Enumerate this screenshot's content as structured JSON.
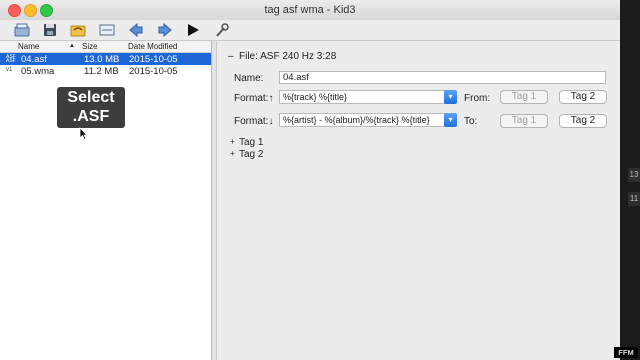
{
  "window": {
    "title": "tag asf wma - Kid3"
  },
  "toolbar": {
    "items": [
      "new-icon",
      "save-icon",
      "revert-icon",
      "playlist-icon",
      "previous-icon",
      "next-icon",
      "play-icon",
      "settings-icon"
    ]
  },
  "files": {
    "columns": {
      "name": "Name",
      "size": "Size",
      "date": "Date Modified"
    },
    "rows": [
      {
        "name": "04.asf",
        "size": "13.0 MB",
        "date": "2015-10-05",
        "selected": true
      },
      {
        "name": "05.wma",
        "size": "11.2 MB",
        "date": "2015-10-05",
        "selected": false
      }
    ]
  },
  "overlay": {
    "line1": "Select",
    "line2": ".ASF"
  },
  "file_panel": {
    "header": "File: ASF 240 Hz 3:28",
    "name_label": "Name:",
    "name_value": "04.asf",
    "format_up_label": "Format:↑",
    "format_up_value": "%{track} %{title}",
    "from_label": "From:",
    "format_down_label": "Format:↓",
    "format_down_value": "%{artist} - %{album}/%{track} %{title}",
    "to_label": "To:",
    "tag1_button": "Tag 1",
    "tag2_button": "Tag 2"
  },
  "sections": {
    "tag1": "Tag 1",
    "tag2": "Tag 2"
  },
  "background": {
    "badge1": "13",
    "badge2": "11",
    "brand": "FFM"
  }
}
